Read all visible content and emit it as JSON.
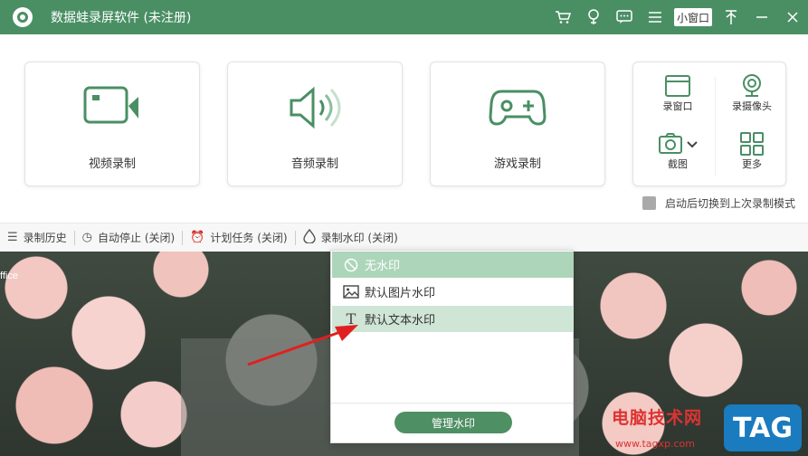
{
  "titlebar": {
    "title": "数据蛙录屏软件 (未注册)",
    "mini_window": "小窗口",
    "icons": [
      "cart-icon",
      "bulb-icon",
      "chat-icon",
      "menu-icon",
      "pin-icon",
      "close-icon"
    ]
  },
  "cards": [
    {
      "label": "视频录制",
      "icon": "video-camera-icon"
    },
    {
      "label": "音频录制",
      "icon": "speaker-icon"
    },
    {
      "label": "游戏录制",
      "icon": "gamepad-icon"
    }
  ],
  "tools": {
    "window": "录窗口",
    "webcam": "录摄像头",
    "screenshot": "截图",
    "more": "更多"
  },
  "auto_switch": "启动后切换到上次录制模式",
  "statusbar": {
    "history": "录制历史",
    "auto_stop": "自动停止 (关闭)",
    "schedule": "计划任务 (关闭)",
    "watermark": "录制水印 (关闭)"
  },
  "preview": {
    "overlay_text": "ffice"
  },
  "watermark_menu": {
    "items": [
      {
        "label": "无水印",
        "icon": "no-symbol-icon",
        "state": "selected"
      },
      {
        "label": "默认图片水印",
        "icon": "image-icon",
        "state": "normal"
      },
      {
        "label": "默认文本水印",
        "icon": "text-icon",
        "state": "hover"
      }
    ],
    "manage_button": "管理水印"
  },
  "site_watermark": {
    "text": "电脑技术网",
    "url": "www.tagxp.com",
    "tag": "TAG"
  },
  "colors": {
    "accent": "#4a8f64",
    "menu_selected": "#add5b9",
    "menu_hover": "#cfe5d6",
    "annotation_arrow": "#e02020"
  }
}
